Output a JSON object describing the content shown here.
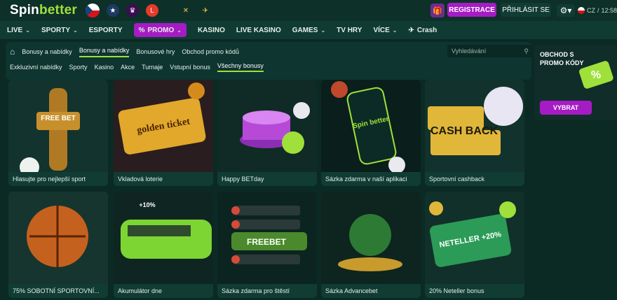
{
  "brand": {
    "spin": "Spin",
    "better": "better"
  },
  "top": {
    "register": "REGISTRACE",
    "login": "PŘIHLÁSIT SE",
    "lang": "CZ",
    "time": "12:58"
  },
  "nav": [
    {
      "label": "LIVE",
      "chev": "⌄"
    },
    {
      "label": "SPORTY",
      "chev": "⌄"
    },
    {
      "label": "ESPORTY",
      "chev": ""
    },
    {
      "label": "PROMO",
      "chev": "⌄",
      "promo": true
    },
    {
      "label": "KASINO",
      "chev": ""
    },
    {
      "label": "LIVE KASINO",
      "chev": ""
    },
    {
      "label": "GAMES",
      "chev": "⌄"
    },
    {
      "label": "TV HRY",
      "chev": ""
    },
    {
      "label": "VÍCE",
      "chev": "⌄"
    },
    {
      "label": "Crash",
      "chev": ""
    }
  ],
  "breadcrumb": {
    "home": "⌂",
    "section": "Bonusy a nabídky",
    "tabs": [
      "Bonusy a nabídky",
      "Bonusové hry",
      "Obchod promo kódů"
    ]
  },
  "search": {
    "placeholder": "Vyhledávání"
  },
  "filters": [
    "Exkluzivní nabídky",
    "Sporty",
    "Kasino",
    "Akce",
    "Turnaje",
    "Vstupní bonus",
    "Všechny bonusy"
  ],
  "cards": [
    {
      "title": "Hlasujte pro nejlepší sport",
      "art": "FREE BET"
    },
    {
      "title": "Vkladová loterie",
      "art": "golden ticket"
    },
    {
      "title": "Happy BETday",
      "art": ""
    },
    {
      "title": "Sázka zdarma v naší aplikaci",
      "art": "Spin better"
    },
    {
      "title": "Sportovní cashback",
      "art": "CASH BACK"
    },
    {
      "title": "75% SOBOTNÍ SPORTOVNÍ...",
      "art": ""
    },
    {
      "title": "Akumulátor dne",
      "art": "+10%"
    },
    {
      "title": "Sázka zdarma pro štěstí",
      "art": "FREEBET"
    },
    {
      "title": "Sázka Advancebet",
      "art": ""
    },
    {
      "title": "20% Neteller bonus",
      "art": "NETELLER +20%"
    }
  ],
  "side": {
    "title": "OBCHOD S PROMO KÓDY",
    "button": "VYBRAT"
  },
  "colors": {
    "bg": "#0b2a24",
    "accent": "#a51cc4",
    "brand_green": "#9fe03a"
  }
}
